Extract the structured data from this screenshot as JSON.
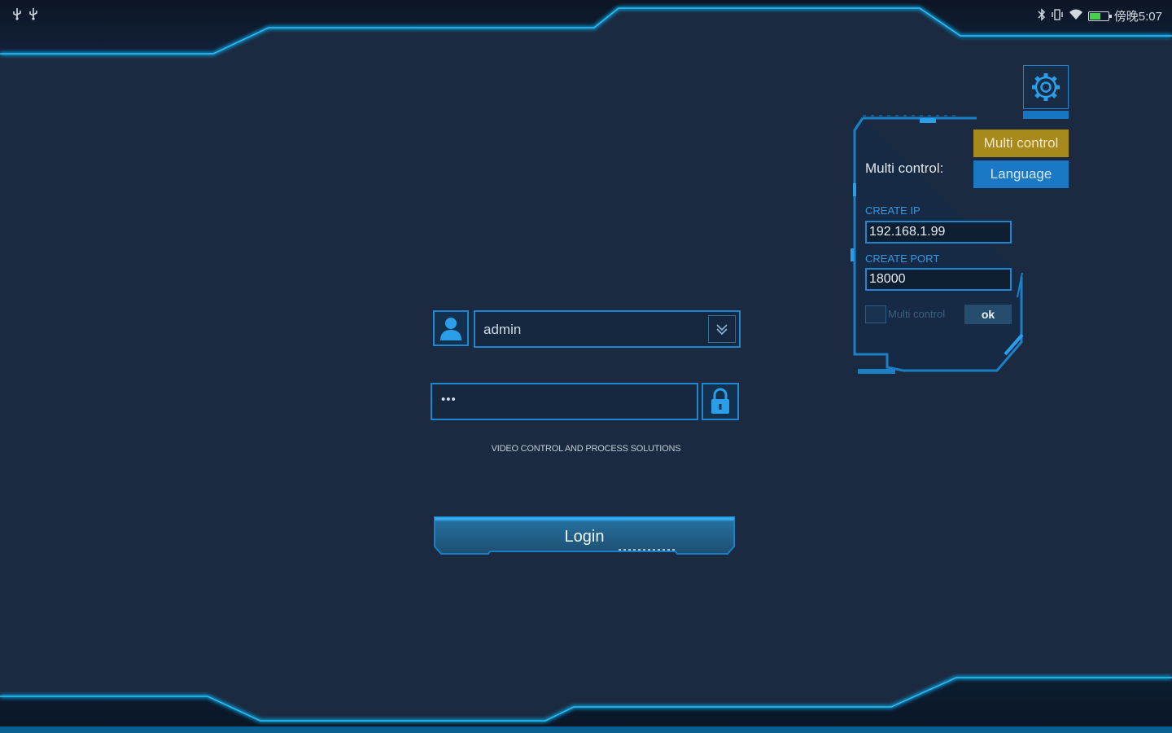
{
  "status_bar": {
    "left_icons": [
      "usb-icon",
      "usb-icon"
    ],
    "time": "傍晚5:07",
    "icons": [
      "bluetooth-icon",
      "vibrate-icon",
      "wifi-icon",
      "battery-icon"
    ]
  },
  "login": {
    "username": "admin",
    "password_masked": "•••",
    "tagline": "VIDEO CONTROL AND PROCESS SOLUTIONS",
    "login_label": "Login"
  },
  "settings_panel": {
    "multi_control_label": "Multi control:",
    "menu": [
      {
        "label": "Multi control",
        "selected": true
      },
      {
        "label": "Language",
        "selected": false
      }
    ],
    "create_ip_label": "CREATE IP",
    "create_ip_value": "192.168.1.99",
    "create_port_label": "CREATE PORT",
    "create_port_value": "18000",
    "checkbox_label": "Multi control",
    "checkbox_checked": false,
    "ok_label": "ok"
  },
  "colors": {
    "background": "#1b2a40",
    "accent": "#1f86d0",
    "highlight_gold": "#a8891b",
    "frame_glow": "#0fa6e6"
  }
}
